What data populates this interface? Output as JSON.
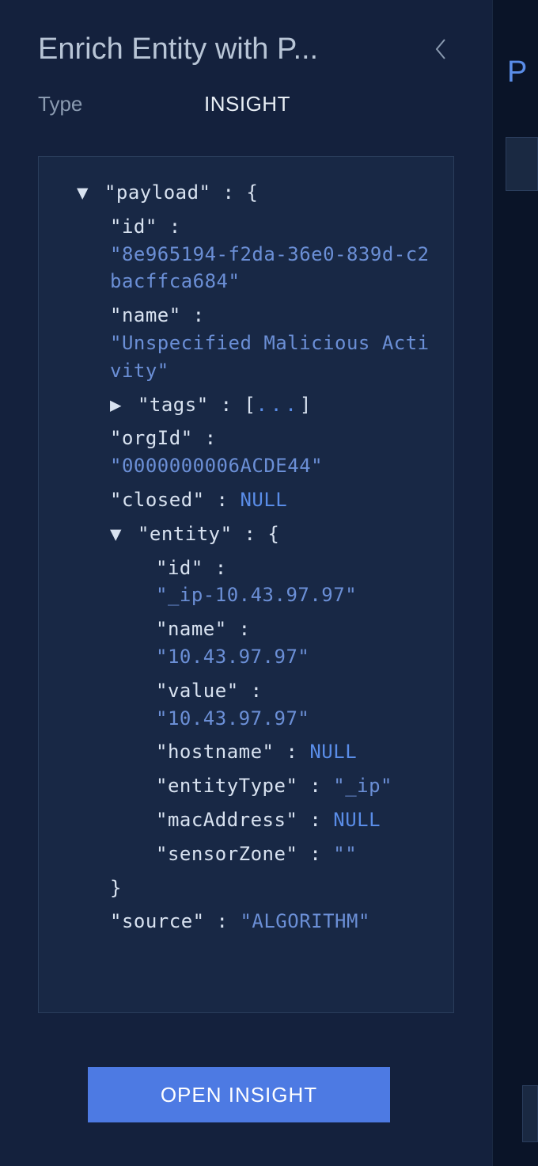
{
  "header": {
    "title": "Enrich Entity with P..."
  },
  "meta": {
    "type_label": "Type",
    "type_value": "INSIGHT"
  },
  "json": {
    "payload_key": "\"payload\"",
    "id_key": "\"id\"",
    "id_val": "\"8e965194-f2da-36e0-839d-c2bacffca684\"",
    "name_key": "\"name\"",
    "name_val": "\"Unspecified Malicious Activity\"",
    "tags_key": "\"tags\"",
    "orgId_key": "\"orgId\"",
    "orgId_val": "\"0000000006ACDE44\"",
    "closed_key": "\"closed\"",
    "null_val": "NULL",
    "entity_key": "\"entity\"",
    "entity_id_key": "\"id\"",
    "entity_id_val": "\"_ip-10.43.97.97\"",
    "entity_name_key": "\"name\"",
    "entity_name_val": "\"10.43.97.97\"",
    "entity_value_key": "\"value\"",
    "entity_value_val": "\"10.43.97.97\"",
    "hostname_key": "\"hostname\"",
    "entityType_key": "\"entityType\"",
    "entityType_val": "\"_ip\"",
    "macAddress_key": "\"macAddress\"",
    "sensorZone_key": "\"sensorZone\"",
    "sensorZone_val": "\"\"",
    "source_key": "\"source\"",
    "source_val": "\"ALGORITHM\""
  },
  "button": {
    "open_label": "OPEN INSIGHT"
  },
  "right": {
    "letter": "P"
  }
}
